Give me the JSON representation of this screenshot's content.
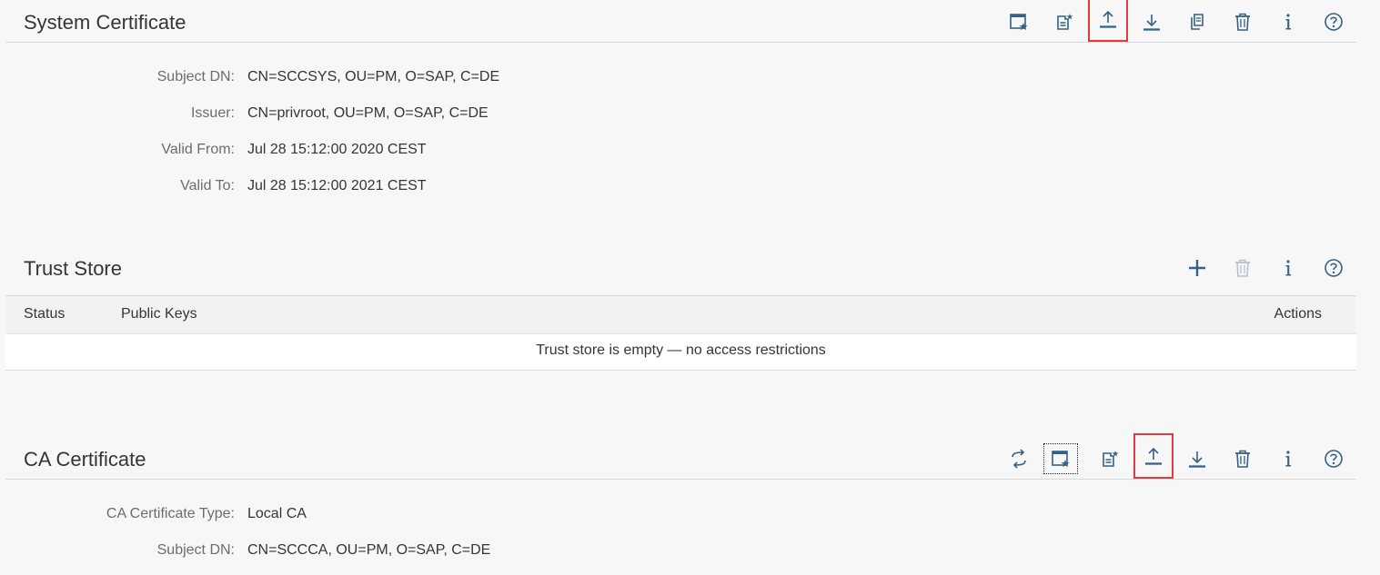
{
  "system_certificate": {
    "title": "System Certificate",
    "fields": [
      {
        "label": "Subject DN:",
        "value": "CN=SCCSYS, OU=PM, O=SAP, C=DE"
      },
      {
        "label": "Issuer:",
        "value": "CN=privroot, OU=PM, O=SAP, C=DE"
      },
      {
        "label": "Valid From:",
        "value": "Jul 28 15:12:00 2020 CEST"
      },
      {
        "label": "Valid To:",
        "value": "Jul 28 15:12:00 2021 CEST"
      }
    ],
    "toolbar": [
      "create-certificate-icon",
      "generate-csr-icon",
      "upload-icon",
      "download-icon",
      "copy-icon",
      "delete-icon",
      "info-icon",
      "help-icon"
    ]
  },
  "trust_store": {
    "title": "Trust Store",
    "columns": {
      "status": "Status",
      "public_keys": "Public Keys",
      "actions": "Actions"
    },
    "empty_text": "Trust store is empty — no access restrictions",
    "toolbar": [
      "add-icon",
      "delete-icon",
      "info-icon",
      "help-icon"
    ]
  },
  "ca_certificate": {
    "title": "CA Certificate",
    "fields": [
      {
        "label": "CA Certificate Type:",
        "value": "Local CA"
      },
      {
        "label": "Subject DN:",
        "value": "CN=SCCCA, OU=PM, O=SAP, C=DE"
      }
    ],
    "toolbar": [
      "switch-icon",
      "create-certificate-icon",
      "generate-csr-icon",
      "upload-icon",
      "download-icon",
      "delete-icon",
      "info-icon",
      "help-icon"
    ]
  },
  "colors": {
    "icon": "#346187",
    "highlight": "#e03c3c"
  }
}
